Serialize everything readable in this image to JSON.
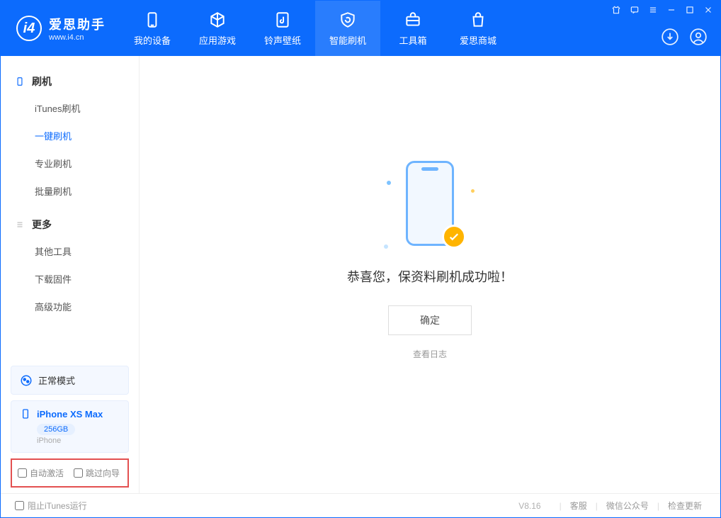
{
  "app": {
    "name": "爱思助手",
    "url": "www.i4.cn"
  },
  "nav": {
    "items": [
      {
        "label": "我的设备"
      },
      {
        "label": "应用游戏"
      },
      {
        "label": "铃声壁纸"
      },
      {
        "label": "智能刷机"
      },
      {
        "label": "工具箱"
      },
      {
        "label": "爱思商城"
      }
    ]
  },
  "sidebar": {
    "group1": {
      "title": "刷机",
      "items": [
        "iTunes刷机",
        "一键刷机",
        "专业刷机",
        "批量刷机"
      ]
    },
    "group2": {
      "title": "更多",
      "items": [
        "其他工具",
        "下载固件",
        "高级功能"
      ]
    },
    "mode_label": "正常模式",
    "device": {
      "name": "iPhone XS Max",
      "storage": "256GB",
      "type": "iPhone"
    },
    "check1": "自动激活",
    "check2": "跳过向导"
  },
  "main": {
    "success_text": "恭喜您，保资料刷机成功啦！",
    "ok_label": "确定",
    "log_link": "查看日志"
  },
  "footer": {
    "block_itunes": "阻止iTunes运行",
    "version": "V8.16",
    "links": [
      "客服",
      "微信公众号",
      "检查更新"
    ]
  }
}
